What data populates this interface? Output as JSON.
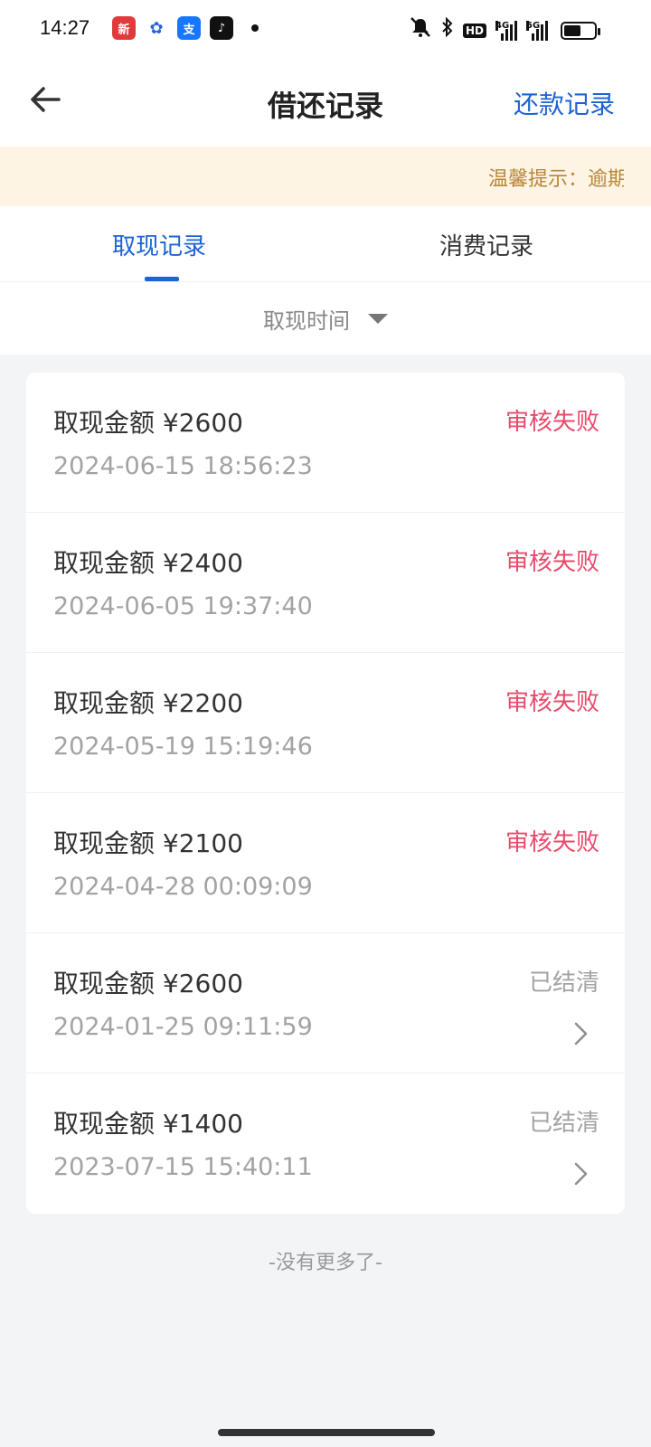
{
  "status_bar": {
    "time": "14:27",
    "apps": [
      {
        "icon": "app-red-icon",
        "color": "#e23a3a",
        "glyph": "新"
      },
      {
        "icon": "baidu-paw-icon",
        "color": "#ffffff",
        "glyph": "✿"
      },
      {
        "icon": "alipay-icon",
        "color": "#1677ff",
        "glyph": "支"
      },
      {
        "icon": "tiktok-icon",
        "color": "#111111",
        "glyph": "♪"
      }
    ],
    "hd_label": "HD",
    "signal_4g": "4G",
    "signal_5g": "5G"
  },
  "header": {
    "title": "借还记录",
    "right_link": "还款记录"
  },
  "notice": {
    "text": "温馨提示：逾期"
  },
  "tabs": [
    {
      "label": "取现记录",
      "active": true
    },
    {
      "label": "消费记录",
      "active": false
    }
  ],
  "filter": {
    "label": "取现时间"
  },
  "records": [
    {
      "amount": "取现金额 ¥2600",
      "date": "2024-06-15 18:56:23",
      "status": "审核失败",
      "type": "fail"
    },
    {
      "amount": "取现金额 ¥2400",
      "date": "2024-06-05 19:37:40",
      "status": "审核失败",
      "type": "fail"
    },
    {
      "amount": "取现金额 ¥2200",
      "date": "2024-05-19 15:19:46",
      "status": "审核失败",
      "type": "fail"
    },
    {
      "amount": "取现金额 ¥2100",
      "date": "2024-04-28 00:09:09",
      "status": "审核失败",
      "type": "fail"
    },
    {
      "amount": "取现金额 ¥2600",
      "date": "2024-01-25 09:11:59",
      "status": "已结清",
      "type": "done"
    },
    {
      "amount": "取现金额 ¥1400",
      "date": "2023-07-15 15:40:11",
      "status": "已结清",
      "type": "done"
    }
  ],
  "footer": {
    "no_more": "-没有更多了-"
  },
  "colors": {
    "accent": "#1e63d6",
    "fail": "#e8496b",
    "muted": "#a3a3a3",
    "notice_bg": "#fdf4e3",
    "notice_text": "#b7863c"
  }
}
